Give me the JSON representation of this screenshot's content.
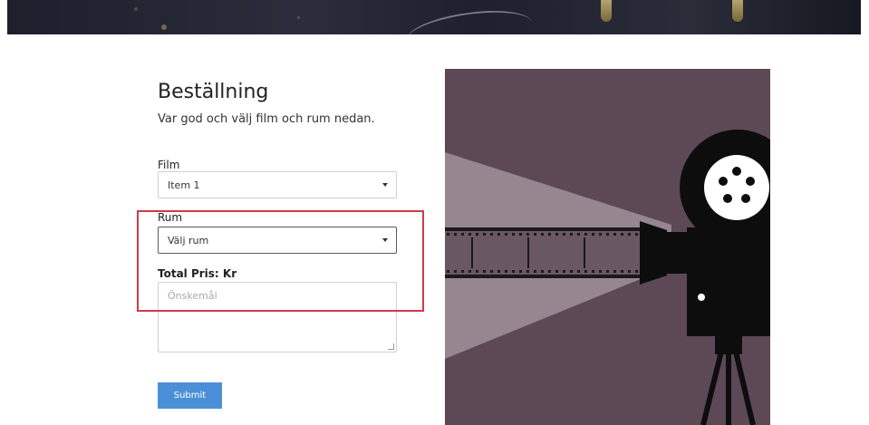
{
  "page": {
    "title": "Beställning",
    "subtitle": "Var god och välj film och rum nedan."
  },
  "form": {
    "film": {
      "label": "Film",
      "value": "Item 1"
    },
    "rum": {
      "label": "Rum",
      "value": "Välj rum"
    },
    "total_label": "Total Pris: Kr",
    "wishes_placeholder": "Önskemål",
    "submit_label": "Submit"
  },
  "colors": {
    "accent": "#4c8fd9",
    "highlight": "#cf3b48",
    "illustration_bg": "#5d4856",
    "projector": "#0d0d0d"
  },
  "icons": [
    "chevron-down-icon",
    "film-projector-illustration",
    "resize-grip-icon"
  ]
}
